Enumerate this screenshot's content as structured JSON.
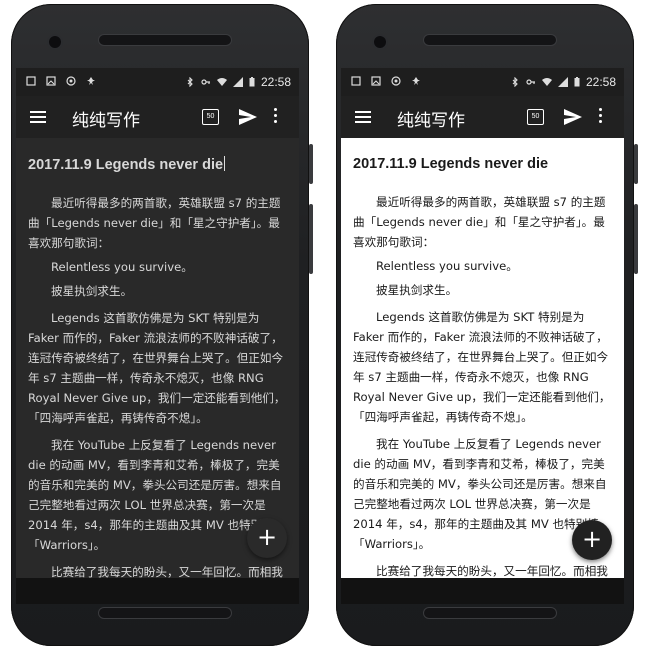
{
  "status": {
    "time": "22:58"
  },
  "toolbar": {
    "title": "纯纯写作",
    "count_badge": "50"
  },
  "doc": {
    "title": "2017.11.9 Legends never die",
    "p1": "最近听得最多的两首歌，英雄联盟 s7 的主题曲「Legends never die」和「星之守护者」。最喜欢那句歌词：",
    "lyric1": "Relentless you survive。",
    "lyric2": "披星执剑求生。",
    "p2": "Legends 这首歌仿佛是为 SKT 特别是为 Faker 而作的，Faker 流浪法师的不败神话破了，连冠传奇被终结了，在世界舞台上哭了。但正如今年 s7 主题曲一样，传奇永不熄灭，也像 RNG Royal Never Give up，我们一定还能看到他们，「四海呼声雀起，再铸传奇不熄」。",
    "p3": "我在 YouTube 上反复看了 Legends never die 的动画 MV，看到李青和艾希，棒极了，完美的音乐和完美的 MV，拳头公司还是厉害。想来自己完整地看过两次 LOL 世界总决赛，第一次是 2014 年，s4，那年的主题曲及其 MV 也特别棒，「Warriors」。",
    "p4": "比赛给了我每天的盼头，又一年回忆。而相我自己已经有一年没玩英雄联盟 LOL 这个游戏了，"
  },
  "fab": {
    "label": "+"
  },
  "colors": {
    "dark_bg": "#292929",
    "light_bg": "#ffffff",
    "toolbar": "#212121"
  }
}
